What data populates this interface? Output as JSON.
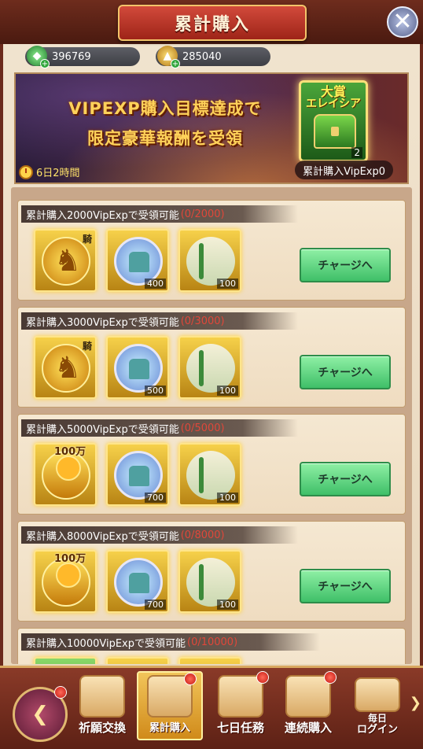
{
  "header": {
    "title": "累計購入"
  },
  "currency": {
    "green": "396769",
    "gold": "285040"
  },
  "banner": {
    "line1": "VIPEXP購入目標達成で",
    "line2": "限定豪華報酬を受領",
    "timer": "6日2時間",
    "prize_label1": "大賞",
    "prize_label2": "エレイシア",
    "prize_count": "2",
    "vip_exp": "累計購入VipExp0"
  },
  "tiers": [
    {
      "title": "累計購入2000VipExpで受領可能",
      "progress": "(0/2000)",
      "first_reward": "horse",
      "first_corner": "騎",
      "island_qty": "400",
      "scroll_qty": "100",
      "button": "チャージへ"
    },
    {
      "title": "累計購入3000VipExpで受領可能",
      "progress": "(0/3000)",
      "first_reward": "horse",
      "first_corner": "騎",
      "island_qty": "500",
      "scroll_qty": "100",
      "button": "チャージへ"
    },
    {
      "title": "累計購入5000VipExpで受領可能",
      "progress": "(0/5000)",
      "first_reward": "gold",
      "first_corner": "100万",
      "island_qty": "700",
      "scroll_qty": "100",
      "button": "チャージへ"
    },
    {
      "title": "累計購入8000VipExpで受領可能",
      "progress": "(0/8000)",
      "first_reward": "gold",
      "first_corner": "100万",
      "island_qty": "700",
      "scroll_qty": "100",
      "button": "チャージへ"
    },
    {
      "title": "累計購入10000VipExpで受領可能",
      "progress": "(0/10000)"
    }
  ],
  "nav": {
    "tab1": "祈願交換",
    "tab2": "累計購入",
    "tab3": "七日任務",
    "tab4": "連続購入",
    "tab5_l1": "毎日",
    "tab5_l2": "ログイン"
  },
  "icons": [
    "close-icon",
    "green-gem-icon",
    "gold-ingot-icon",
    "clock-icon",
    "chest-icon",
    "horse-emblem-icon",
    "island-crystal-icon",
    "scroll-icon",
    "gold-bar-icon",
    "back-arrow-icon",
    "rose-icon",
    "coin-pile-icon",
    "cards-icon",
    "money-bag-icon",
    "gift-box-icon",
    "chevron-right-icon"
  ],
  "colors": {
    "accent_red": "#c41a12",
    "button_green": "#3fbf68",
    "progress_red": "#e0473a"
  }
}
